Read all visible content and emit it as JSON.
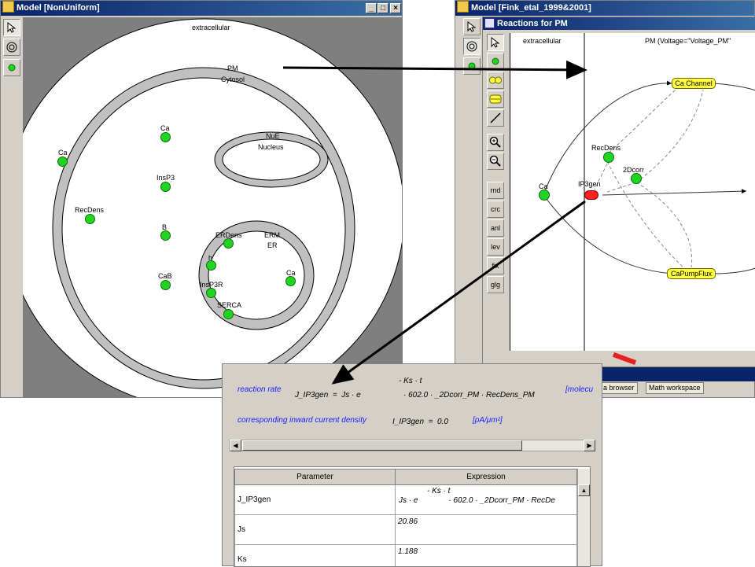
{
  "left_window": {
    "title": "Model [NonUniform]",
    "controls": [
      "_",
      "□",
      "×"
    ],
    "compartments": {
      "outer": "extracellular",
      "membrane": "PM",
      "cytosol": "Cytosol",
      "nuclear_membrane": "NuE",
      "nucleus": "Nucleus",
      "er_membrane": "ERM",
      "er": "ER"
    },
    "species": [
      "Ca",
      "InsP3",
      "B",
      "CaB",
      "Ca",
      "RecDens",
      "ERDens",
      "h",
      "InsP3R",
      "SERCA",
      "Ca"
    ]
  },
  "right_window": {
    "title": "Model [Fink_etal_1999&2001]",
    "subtitle": "Reactions for PM",
    "region_left": "extracellular",
    "region_right": "PM (Voltage=\"Voltage_PM\"",
    "tool_buttons": [
      "rnd",
      "crc",
      "anl",
      "lev",
      "fix",
      "glg"
    ],
    "nodes": {
      "channel": "Ca Channel",
      "pump": "CaPumpFlux",
      "ca": "Ca",
      "recdens": "RecDens",
      "corr": "2Dcorr",
      "ip3gen": "IP3gen"
    },
    "bottom_buttons": [
      "a browser",
      "Math workspace"
    ]
  },
  "bottom_panel": {
    "reaction_label": "reaction rate",
    "exp_top": "- Ks · t",
    "rate_eq_lhs": "J_IP3gen  =  Js · e",
    "rate_eq_rhs": "· 602.0 · _2Dcorr_PM · RecDens_PM",
    "units_right": "[molecu",
    "current_label": "corresponding inward current density",
    "current_eq": "I_IP3gen  =  0.0",
    "current_units": "[pA/μm²]",
    "table": {
      "headers": [
        "Parameter",
        "Expression"
      ],
      "rows": [
        {
          "param": "J_IP3gen",
          "exp_top": "- Ks · t",
          "expr": "Js · e              · 602.0 · _2Dcorr_PM · RecDe"
        },
        {
          "param": "Js",
          "expr": "20.86"
        },
        {
          "param": "Ks",
          "expr": "1.188"
        }
      ]
    }
  },
  "colors": {
    "species": "#22d422",
    "node": "#ffff40",
    "ip3gen": "#ff2020",
    "title": "#0a246a",
    "link_text": "#1a1aff"
  }
}
